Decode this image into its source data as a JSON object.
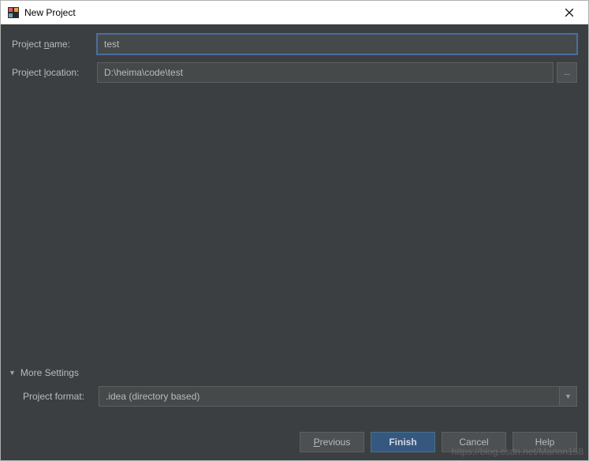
{
  "titlebar": {
    "title": "New Project"
  },
  "form": {
    "project_name": {
      "label_prefix": "Project ",
      "label_mnemonic": "n",
      "label_suffix": "ame:",
      "value": "test"
    },
    "project_location": {
      "label_prefix": "Project ",
      "label_mnemonic": "l",
      "label_suffix": "ocation:",
      "value": "D:\\heima\\code\\test"
    },
    "browse_label": "..."
  },
  "more_settings": {
    "header": "More Settings",
    "project_format": {
      "label": "Project format:",
      "value": ".idea (directory based)"
    }
  },
  "buttons": {
    "previous_mnemonic": "P",
    "previous_suffix": "revious",
    "finish": "Finish",
    "cancel": "Cancel",
    "help": "Help"
  },
  "watermark": "https://blog.csdn.net/Marion158"
}
